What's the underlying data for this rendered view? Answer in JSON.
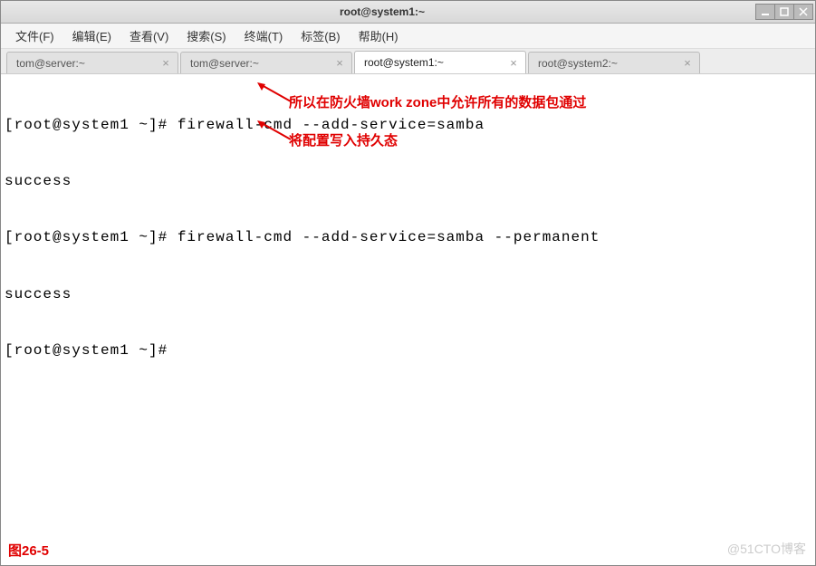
{
  "window": {
    "title": "root@system1:~"
  },
  "menu": {
    "file": "文件(F)",
    "edit": "编辑(E)",
    "view": "查看(V)",
    "search": "搜索(S)",
    "terminal": "终端(T)",
    "tabs": "标签(B)",
    "help": "帮助(H)"
  },
  "tabs": [
    {
      "label": "tom@server:~",
      "active": false
    },
    {
      "label": "tom@server:~",
      "active": false
    },
    {
      "label": "root@system1:~",
      "active": true
    },
    {
      "label": "root@system2:~",
      "active": false
    }
  ],
  "terminal": {
    "lines": [
      "[root@system1 ~]# firewall-cmd --add-service=samba",
      "success",
      "[root@system1 ~]# firewall-cmd --add-service=samba --permanent",
      "success",
      "[root@system1 ~]# "
    ]
  },
  "annotations": {
    "a1": "所以在防火墙work zone中允许所有的数据包通过",
    "a2": "将配置写入持久态"
  },
  "figure_label": "图26-5",
  "watermark": "@51CTO博客"
}
